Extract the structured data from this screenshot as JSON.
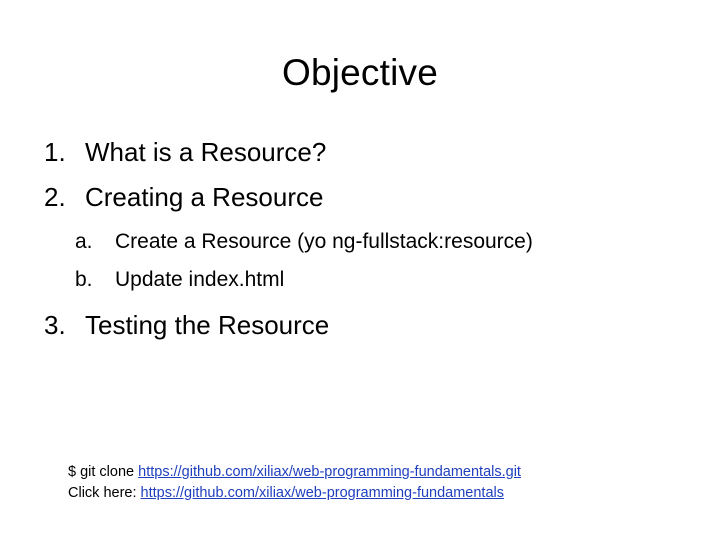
{
  "slide": {
    "title": "Objective",
    "items": [
      {
        "marker": "1.",
        "text": "What is a Resource?"
      },
      {
        "marker": "2.",
        "text": "Creating a Resource",
        "subitems": [
          {
            "marker": "a.",
            "text": "Create a Resource (yo ng-fullstack:resource)"
          },
          {
            "marker": "b.",
            "text": "Update index.html"
          }
        ]
      },
      {
        "marker": "3.",
        "text": "Testing the Resource"
      }
    ],
    "footer": {
      "line1_prefix": "$ git clone ",
      "line1_link": "https://github.com/xiliax/web-programming-fundamentals.git",
      "line2_prefix": "Click here: ",
      "line2_link": "https://github.com/xiliax/web-programming-fundamentals"
    },
    "link_color": "#1f3fbf"
  }
}
